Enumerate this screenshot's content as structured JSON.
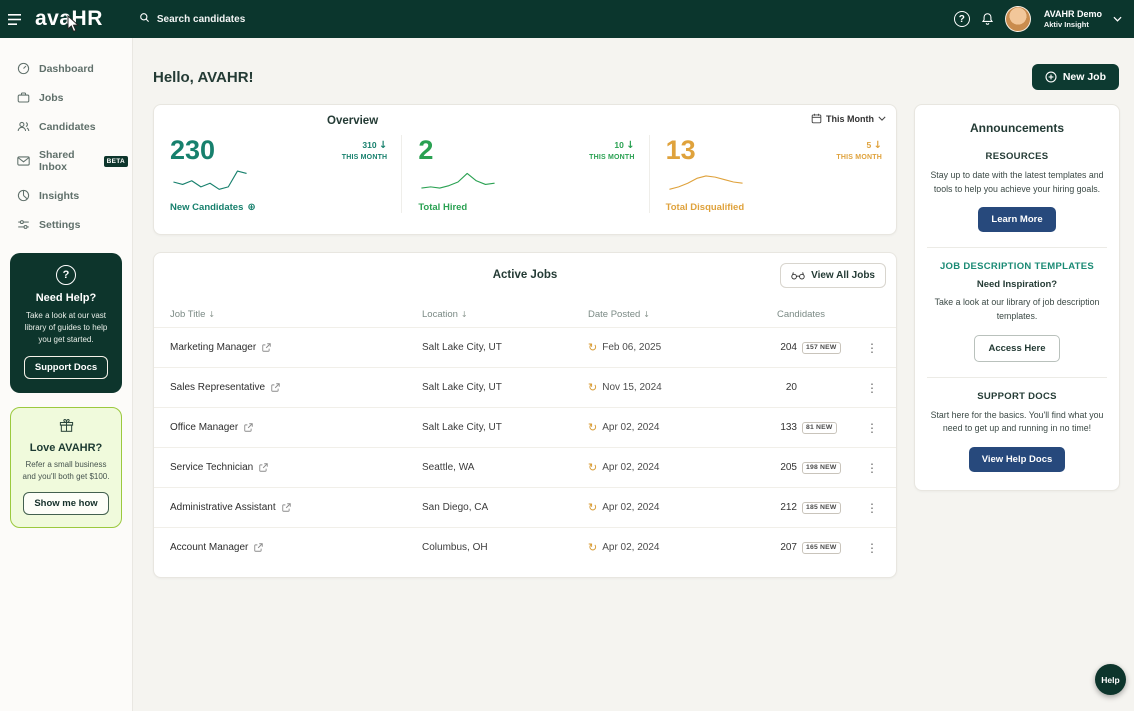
{
  "theme": {
    "header_bg": "#0b362d",
    "accent_teal": "#17806d",
    "accent_green": "#2aa152",
    "accent_orange": "#dfa23c",
    "button_navy": "#27497c",
    "refer_border_green": "#9bc93e"
  },
  "topbar": {
    "logo": "avaHR",
    "search_placeholder": "Search candidates",
    "user": {
      "name": "AVAHR Demo",
      "org": "Aktiv Insight"
    },
    "icons": [
      "menu-icon",
      "search-icon",
      "help-circle-icon",
      "bell-icon",
      "avatar",
      "chevron-down-icon"
    ]
  },
  "sidebar": {
    "items": [
      {
        "label": "Dashboard",
        "icon": "gauge-icon"
      },
      {
        "label": "Jobs",
        "icon": "briefcase-icon"
      },
      {
        "label": "Candidates",
        "icon": "users-icon"
      },
      {
        "label": "Shared Inbox",
        "icon": "envelope-icon",
        "badge": "BETA"
      },
      {
        "label": "Insights",
        "icon": "pie-chart-icon"
      },
      {
        "label": "Settings",
        "icon": "sliders-icon"
      }
    ],
    "help_card": {
      "icon": "question-circle-icon",
      "title": "Need Help?",
      "body": "Take a look at our vast library of guides to help you get started.",
      "button": "Support Docs"
    },
    "refer_card": {
      "icon": "gift-icon",
      "title": "Love AVAHR?",
      "body": "Refer a small business and you'll both get $100.",
      "button": "Show me how"
    }
  },
  "main": {
    "greeting": "Hello, AVAHR!",
    "new_job_label": "New Job",
    "overview": {
      "title": "Overview",
      "period": "This Month",
      "stats": [
        {
          "value": "230",
          "delta": "310",
          "delta_label": "THIS MONTH",
          "label": "New Candidates",
          "color": "#17806d",
          "spark": [
            5,
            4,
            5.5,
            3,
            4.5,
            2,
            3,
            9.5,
            8.5
          ]
        },
        {
          "value": "2",
          "delta": "10",
          "delta_label": "THIS MONTH",
          "label": "Total Hired",
          "color": "#2aa152",
          "spark": [
            2.5,
            3,
            2.5,
            3.5,
            5,
            8.5,
            5.5,
            4,
            4.5
          ]
        },
        {
          "value": "13",
          "delta": "5",
          "delta_label": "THIS MONTH",
          "label": "Total Disqualified",
          "color": "#dfa23c",
          "spark": [
            2,
            3,
            4.5,
            6.5,
            7.5,
            7,
            6,
            5,
            4.5
          ]
        }
      ]
    },
    "active_jobs": {
      "title": "Active Jobs",
      "view_all_label": "View All Jobs",
      "columns": [
        {
          "label": "Job Title",
          "sortable": true
        },
        {
          "label": "Location",
          "sortable": true
        },
        {
          "label": "Date Posted",
          "sortable": true
        },
        {
          "label": "Candidates",
          "sortable": false
        }
      ],
      "rows": [
        {
          "title": "Marketing Manager",
          "location": "Salt Lake City, UT",
          "date": "Feb 06, 2025",
          "candidates": "204",
          "new_badge": "157 NEW"
        },
        {
          "title": "Sales Representative",
          "location": "Salt Lake City, UT",
          "date": "Nov 15, 2024",
          "candidates": "20",
          "new_badge": ""
        },
        {
          "title": "Office Manager",
          "location": "Salt Lake City, UT",
          "date": "Apr 02, 2024",
          "candidates": "133",
          "new_badge": "81 NEW"
        },
        {
          "title": "Service Technician",
          "location": "Seattle, WA",
          "date": "Apr 02, 2024",
          "candidates": "205",
          "new_badge": "198 NEW"
        },
        {
          "title": "Administrative Assistant",
          "location": "San Diego, CA",
          "date": "Apr 02, 2024",
          "candidates": "212",
          "new_badge": "185 NEW"
        },
        {
          "title": "Account Manager",
          "location": "Columbus, OH",
          "date": "Apr 02, 2024",
          "candidates": "207",
          "new_badge": "165 NEW"
        }
      ]
    }
  },
  "announcements": {
    "title": "Announcements",
    "sections": [
      {
        "heading": "RESOURCES",
        "subheading": "",
        "body": "Stay up to date with the latest templates and tools to help you achieve your hiring goals.",
        "button": "Learn More",
        "button_style": "solid"
      },
      {
        "heading": "JOB DESCRIPTION TEMPLATES",
        "subheading": "Need Inspiration?",
        "body": "Take a look at our library of job description templates.",
        "button": "Access Here",
        "button_style": "outline"
      },
      {
        "heading": "SUPPORT DOCS",
        "subheading": "",
        "body": "Start here for the basics. You'll find what you need to get up and running in no time!",
        "button": "View Help Docs",
        "button_style": "solid"
      }
    ]
  },
  "help_fab_label": "Help"
}
